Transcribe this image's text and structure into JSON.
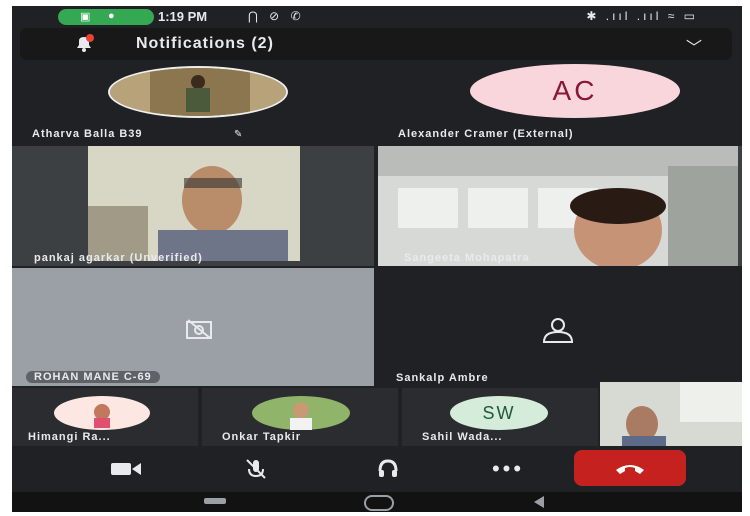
{
  "status_bar": {
    "time": "1:19 PM",
    "left_icons": "⋂ ⊘ ✆",
    "right_icons": "✱ .ııl .ııl ≈ ▭"
  },
  "notifications": {
    "label": "Notifications (2)"
  },
  "tiles": [
    {
      "name": "Atharva Balla B39"
    },
    {
      "name": "Alexander Cramer (External)",
      "initials": "AC"
    },
    {
      "name": "pankaj agarkar (Unverified)"
    },
    {
      "name": "Sangeeta Mohapatra"
    },
    {
      "name": "ROHAN MANE C-69"
    },
    {
      "name": "Sankalp Ambre"
    }
  ],
  "strip": [
    {
      "name": "Himangi Ra..."
    },
    {
      "name": "Onkar Tapkir"
    },
    {
      "name": "Sahil Wada...",
      "initials": "SW"
    }
  ],
  "colors": {
    "background": "#202124",
    "tile": "#3c4043",
    "hangup": "#c5221f",
    "ac_avatar": "#f9d6dc",
    "sw_avatar": "#d4ecd9"
  }
}
